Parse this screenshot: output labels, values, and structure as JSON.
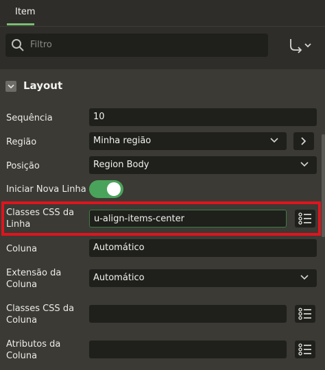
{
  "tabs": {
    "item_label": "Item"
  },
  "search": {
    "placeholder": "Filtro"
  },
  "section": {
    "title": "Layout"
  },
  "fields": {
    "sequencia": {
      "label": "Sequência",
      "value": "10"
    },
    "regiao": {
      "label": "Região",
      "value": "Minha região"
    },
    "posicao": {
      "label": "Posição",
      "value": "Region Body"
    },
    "iniciar_nova_linha": {
      "label": "Iniciar Nova Linha",
      "value": true
    },
    "classes_css_linha": {
      "label_line1": "Classes CSS da",
      "label_line2": "Linha",
      "value": "u-align-items-center"
    },
    "coluna": {
      "label": "Coluna",
      "value": "Automático"
    },
    "extensao_coluna": {
      "label_line1": "Extensão da",
      "label_line2": "Coluna",
      "value": "Automático"
    },
    "classes_css_coluna": {
      "label_line1": "Classes CSS da",
      "label_line2": "Coluna",
      "value": ""
    },
    "atributos_coluna": {
      "label_line1": "Atributos da",
      "label_line2": "Coluna",
      "value": ""
    }
  },
  "colors": {
    "accent_green": "#4aa35b",
    "highlight_red": "#e0141e",
    "panel_bg": "#3b3a34"
  },
  "icons": [
    "search-icon",
    "goto-arrow-icon",
    "chevron-down-icon",
    "chevron-right-icon",
    "list-icon",
    "collapse-icon"
  ]
}
